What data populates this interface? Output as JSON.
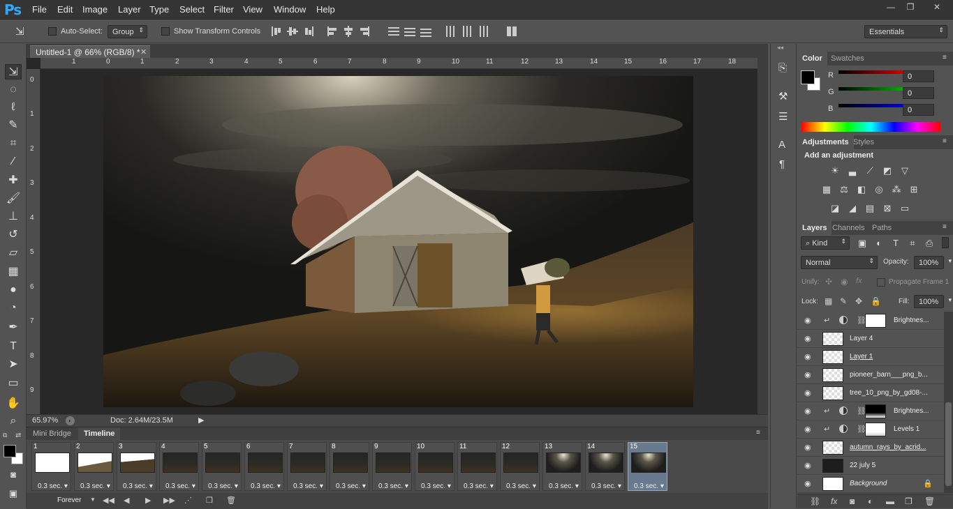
{
  "app": {
    "logo": "Ps"
  },
  "menu": [
    "File",
    "Edit",
    "Image",
    "Layer",
    "Type",
    "Select",
    "Filter",
    "View",
    "Window",
    "Help"
  ],
  "window_controls": {
    "minimize": "—",
    "restore": "❐",
    "close": "✕"
  },
  "options_bar": {
    "auto_select_label": "Auto-Select:",
    "auto_select_value": "Group",
    "show_transform_label": "Show Transform Controls",
    "workspace": "Essentials"
  },
  "document": {
    "tab_title": "Untitled-1 @ 66% (RGB/8) *",
    "zoom": "65.97%",
    "doc_info": "Doc: 2.64M/23.5M",
    "ruler_top": [
      "1",
      "0",
      "1",
      "2",
      "3",
      "4",
      "5",
      "6",
      "7",
      "8",
      "9",
      "10",
      "11",
      "12",
      "13",
      "14",
      "15",
      "16",
      "17",
      "18"
    ],
    "ruler_left": [
      "0",
      "1",
      "2",
      "3",
      "4",
      "5",
      "6",
      "7",
      "8",
      "9"
    ]
  },
  "bottom_panel": {
    "tabs": [
      "Mini Bridge",
      "Timeline"
    ],
    "active_tab": "Timeline",
    "frames": [
      {
        "num": "1",
        "delay": "0.3 sec."
      },
      {
        "num": "2",
        "delay": "0.3 sec."
      },
      {
        "num": "3",
        "delay": "0.3 sec."
      },
      {
        "num": "4",
        "delay": "0.3 sec."
      },
      {
        "num": "5",
        "delay": "0.3 sec."
      },
      {
        "num": "6",
        "delay": "0.3 sec."
      },
      {
        "num": "7",
        "delay": "0.3 sec."
      },
      {
        "num": "8",
        "delay": "0.3 sec."
      },
      {
        "num": "9",
        "delay": "0.3 sec."
      },
      {
        "num": "10",
        "delay": "0.3 sec."
      },
      {
        "num": "11",
        "delay": "0.3 sec."
      },
      {
        "num": "12",
        "delay": "0.3 sec."
      },
      {
        "num": "13",
        "delay": "0.3 sec."
      },
      {
        "num": "14",
        "delay": "0.3 sec."
      },
      {
        "num": "15",
        "delay": "0.3 sec."
      }
    ],
    "selected_frame": "15",
    "loop": "Forever"
  },
  "color_panel": {
    "tabs": [
      "Color",
      "Swatches"
    ],
    "channels": [
      {
        "label": "R",
        "value": "0",
        "color": "#e00000"
      },
      {
        "label": "G",
        "value": "0",
        "color": "#00c000"
      },
      {
        "label": "B",
        "value": "0",
        "color": "#0000e0"
      }
    ]
  },
  "adjustments_panel": {
    "tabs": [
      "Adjustments",
      "Styles"
    ],
    "heading": "Add an adjustment"
  },
  "layers_panel": {
    "tabs": [
      "Layers",
      "Channels",
      "Paths"
    ],
    "filter": "Kind",
    "blend_mode": "Normal",
    "opacity_label": "Opacity:",
    "opacity": "100%",
    "unify_label": "Unify:",
    "propagate_label": "Propagate Frame 1",
    "lock_label": "Lock:",
    "fill_label": "Fill:",
    "fill": "100%",
    "layers": [
      {
        "name": "Brightnes...",
        "kind": "adjustment"
      },
      {
        "name": "Layer 4",
        "kind": "pixel"
      },
      {
        "name": "Layer 1",
        "kind": "pixel"
      },
      {
        "name": "pioneer_barn___png_b...",
        "kind": "pixel"
      },
      {
        "name": "tree_10_png_by_gd08-...",
        "kind": "pixel"
      },
      {
        "name": "Brightnes...",
        "kind": "adjustment"
      },
      {
        "name": "Levels 1",
        "kind": "adjustment"
      },
      {
        "name": "autumn_rays_by_acrid...",
        "kind": "pixel"
      },
      {
        "name": "22 july 5",
        "kind": "pixel"
      },
      {
        "name": "Background",
        "kind": "background"
      }
    ]
  }
}
